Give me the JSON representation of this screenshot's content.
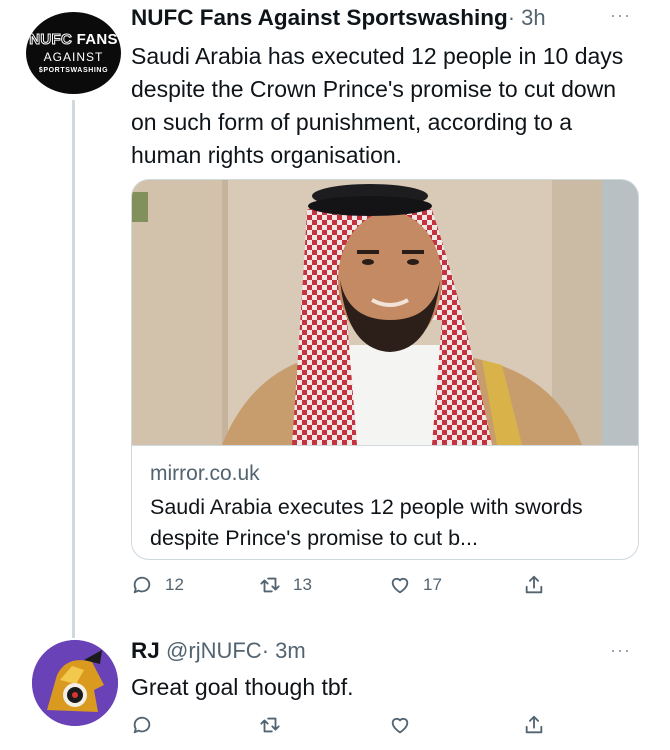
{
  "tweet": {
    "author_name": "NUFC Fans Against Sportswashing",
    "timestamp": "· 3h",
    "more_label": "···",
    "avatar_text": {
      "line1_outline": "NUFC",
      "line1_bold": "FANS",
      "line2": "AGAINST",
      "line3": "$PORTSWASHING"
    },
    "text": "Saudi Arabia has executed 12 people in 10 days despite the Crown Prince's promise to cut down on such form of punishment, according to a human rights organisation.",
    "card": {
      "domain": "mirror.co.uk",
      "title": "Saudi Arabia executes 12 people with swords despite Prince's promise to cut b..."
    },
    "actions": {
      "replies": "12",
      "retweets": "13",
      "likes": "17"
    }
  },
  "reply": {
    "author_name": "RJ",
    "handle": "@rjNUFC",
    "timestamp": "· 3m",
    "more_label": "···",
    "text": "Great goal though tbf."
  },
  "colors": {
    "text": "#0f1419",
    "secondary": "#536471",
    "border": "#cfd9de",
    "thread_line": "#cfd9de"
  },
  "icons": [
    "reply-icon",
    "retweet-icon",
    "like-icon",
    "share-icon",
    "more-icon"
  ]
}
